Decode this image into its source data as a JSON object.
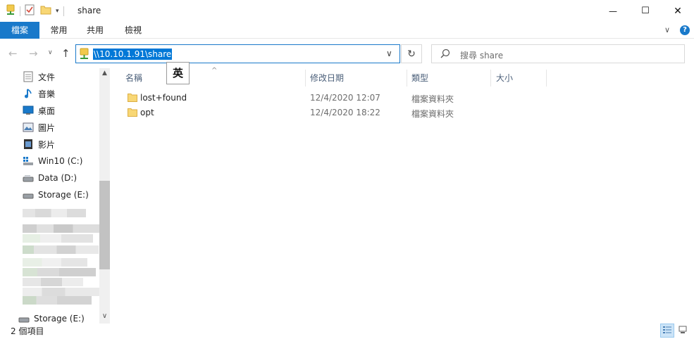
{
  "window": {
    "title": "share",
    "minimize_glyph": "—",
    "maximize_glyph": "☐",
    "close_glyph": "✕"
  },
  "ribbon": {
    "tabs": [
      {
        "label": "檔案",
        "active": true
      },
      {
        "label": "常用",
        "active": false
      },
      {
        "label": "共用",
        "active": false
      },
      {
        "label": "檢視",
        "active": false
      }
    ],
    "help_glyph": "?",
    "collapse_glyph": "∨"
  },
  "nav": {
    "back_glyph": "←",
    "forward_glyph": "→",
    "recent_glyph": "∨",
    "up_glyph": "↑",
    "address": "\\\\10.10.1.91\\share",
    "address_dropdown_glyph": "∨",
    "refresh_glyph": "↻",
    "search_placeholder": "搜尋 share"
  },
  "ime": {
    "label": "英"
  },
  "sidebar": {
    "items": [
      {
        "label": "文件",
        "icon": "documents-icon"
      },
      {
        "label": "音樂",
        "icon": "music-icon"
      },
      {
        "label": "桌面",
        "icon": "desktop-icon"
      },
      {
        "label": "圖片",
        "icon": "pictures-icon"
      },
      {
        "label": "影片",
        "icon": "videos-icon"
      },
      {
        "label": "Win10 (C:)",
        "icon": "system-drive-icon"
      },
      {
        "label": "Data (D:)",
        "icon": "drive-icon"
      },
      {
        "label": "Storage (E:)",
        "icon": "drive-icon"
      }
    ],
    "bottom_item": {
      "label": "Storage (E:)",
      "icon": "drive-icon"
    },
    "scroll_up_glyph": "▲",
    "scroll_down_glyph": "∨"
  },
  "columns": [
    {
      "key": "name",
      "label": "名稱"
    },
    {
      "key": "modified",
      "label": "修改日期"
    },
    {
      "key": "type",
      "label": "類型"
    },
    {
      "key": "size",
      "label": "大小"
    }
  ],
  "sort_glyph": "^",
  "files": [
    {
      "name": "lost+found",
      "modified": "12/4/2020 12:07",
      "type": "檔案資料夾"
    },
    {
      "name": "opt",
      "modified": "12/4/2020 18:22",
      "type": "檔案資料夾"
    }
  ],
  "status": {
    "item_count": "2 個項目"
  },
  "colors": {
    "accent": "#1979ca",
    "selection": "#0078d7",
    "folder": "#f8d775"
  }
}
